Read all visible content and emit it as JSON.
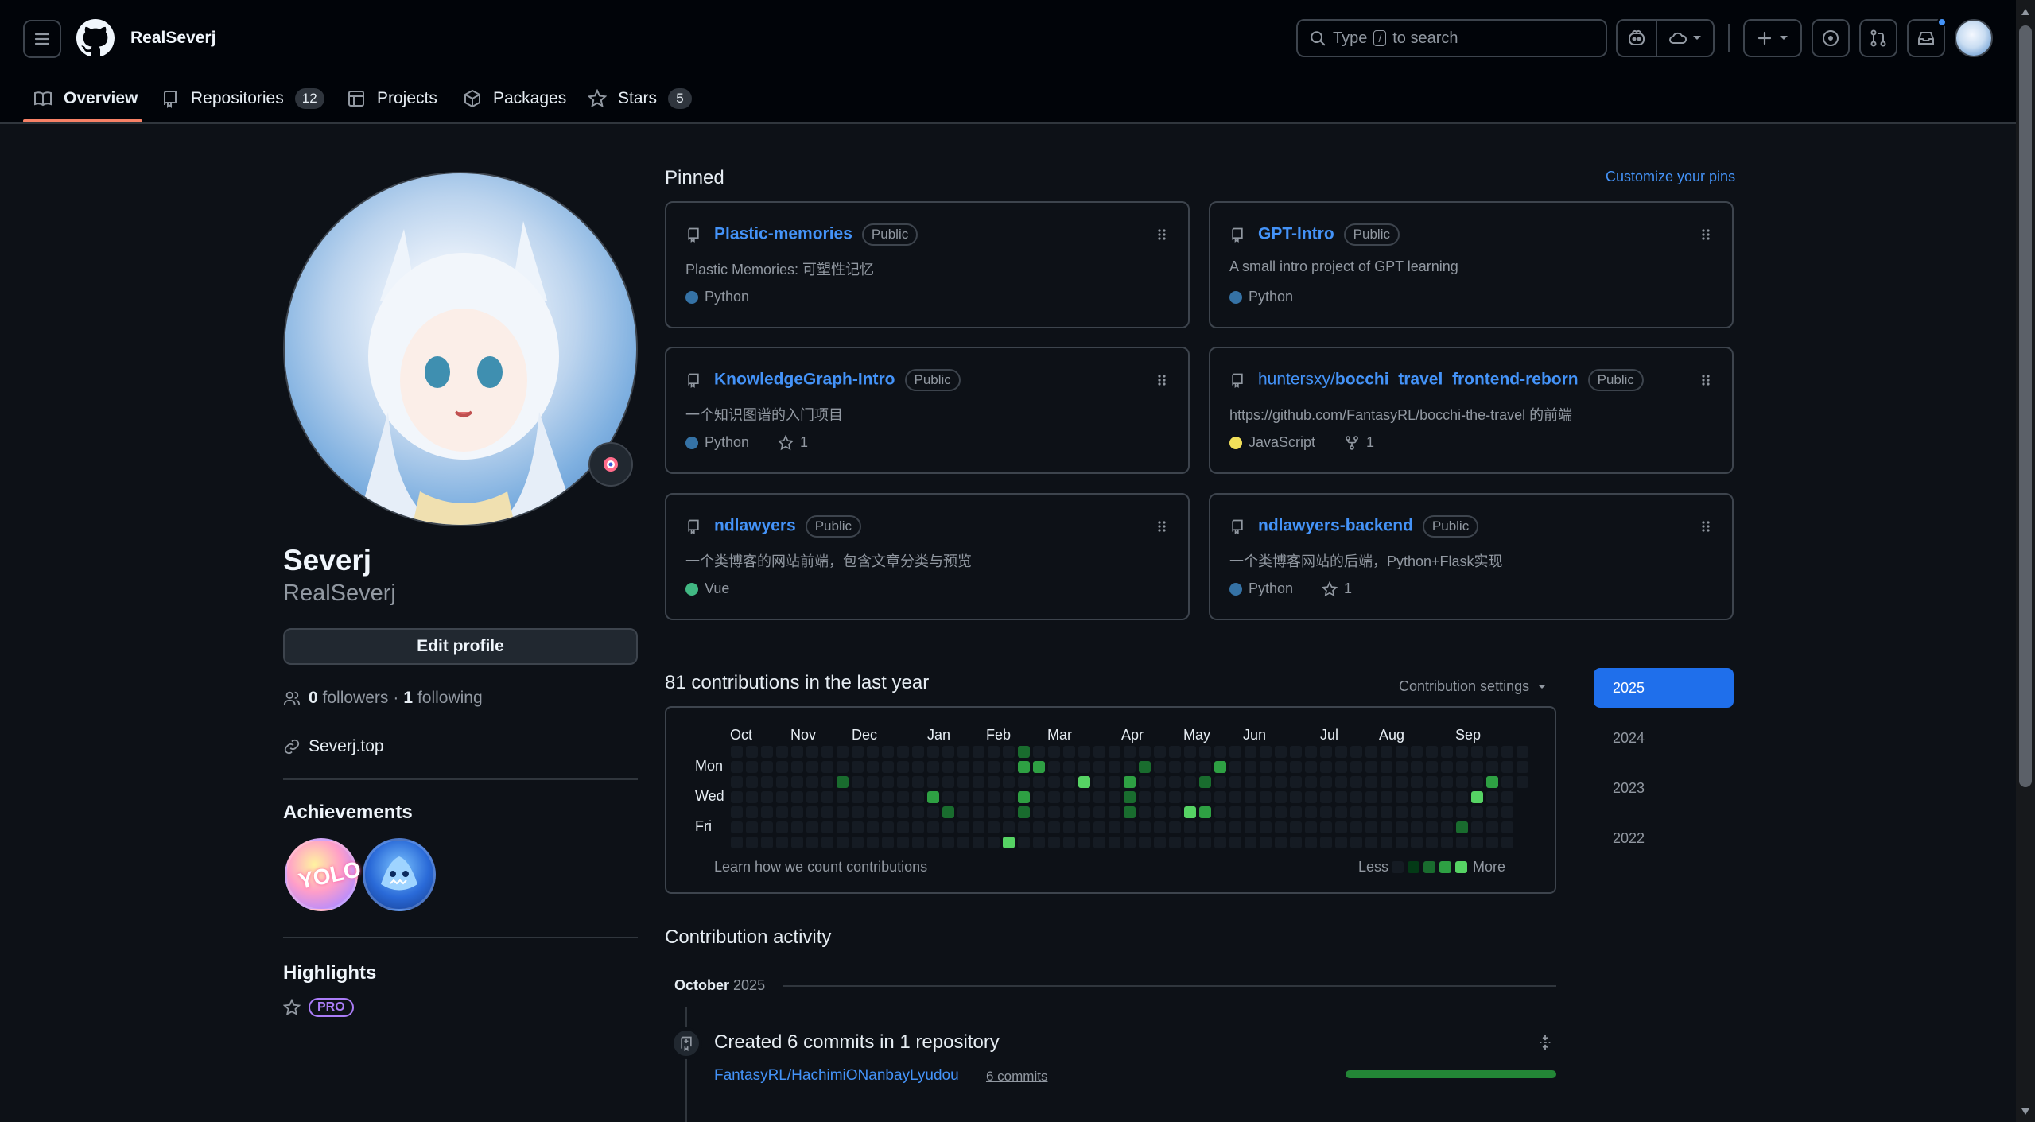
{
  "header": {
    "username": "RealSeverj",
    "search_prefix": "Type",
    "search_key": "/",
    "search_suffix": "to search"
  },
  "tabs": [
    {
      "label": "Overview",
      "count": null
    },
    {
      "label": "Repositories",
      "count": "12"
    },
    {
      "label": "Projects",
      "count": null
    },
    {
      "label": "Packages",
      "count": null
    },
    {
      "label": "Stars",
      "count": "5"
    }
  ],
  "profile": {
    "name": "Severj",
    "login": "RealSeverj",
    "edit_button": "Edit profile",
    "followers_count": "0",
    "followers_label": "followers",
    "separator": "·",
    "following_count": "1",
    "following_label": "following",
    "website": "Severj.top",
    "achievements_title": "Achievements",
    "highlights_title": "Highlights",
    "pro_badge": "PRO"
  },
  "pinned": {
    "title": "Pinned",
    "customize_link": "Customize your pins",
    "items": [
      {
        "name": "Plastic-memories",
        "visibility": "Public",
        "description": "Plastic Memories: 可塑性记忆",
        "language": "Python",
        "language_color": "#3572A5",
        "stars": null,
        "forks": null
      },
      {
        "name": "GPT-Intro",
        "visibility": "Public",
        "description": "A small intro project of GPT learning",
        "language": "Python",
        "language_color": "#3572A5",
        "stars": null,
        "forks": null
      },
      {
        "name": "KnowledgeGraph-Intro",
        "visibility": "Public",
        "description": "一个知识图谱的入门项目",
        "language": "Python",
        "language_color": "#3572A5",
        "stars": "1",
        "forks": null
      },
      {
        "owner": "huntersxy/",
        "name": "bocchi_travel_frontend-reborn",
        "visibility": "Public",
        "description": "https://github.com/FantasyRL/bocchi-the-travel 的前端",
        "language": "JavaScript",
        "language_color": "#f1e05a",
        "stars": null,
        "forks": "1"
      },
      {
        "name": "ndlawyers",
        "visibility": "Public",
        "description": "一个类博客的网站前端，包含文章分类与预览",
        "language": "Vue",
        "language_color": "#41b883",
        "stars": null,
        "forks": null
      },
      {
        "name": "ndlawyers-backend",
        "visibility": "Public",
        "description": "一个类博客网站的后端，Python+Flask实现",
        "language": "Python",
        "language_color": "#3572A5",
        "stars": "1",
        "forks": null
      }
    ]
  },
  "contributions": {
    "title": "81 contributions in the last year",
    "settings_label": "Contribution settings",
    "months": [
      "Oct",
      "Nov",
      "Dec",
      "Jan",
      "Feb",
      "Mar",
      "Apr",
      "May",
      "Jun",
      "Jul",
      "Aug",
      "Sep"
    ],
    "days": [
      "Mon",
      "Wed",
      "Fri"
    ],
    "learn_link": "Learn how we count contributions",
    "less": "Less",
    "more": "More",
    "years": [
      "2025",
      "2024",
      "2023",
      "2022"
    ],
    "active_year": "2025",
    "colors": [
      "#151b23",
      "#033a16",
      "#196c2e",
      "#2ea043",
      "#56d364"
    ]
  },
  "activity": {
    "title": "Contribution activity",
    "month": "October",
    "year": "2025",
    "event_title": "Created 6 commits in 1 repository",
    "repo": "FantasyRL/HachimiONanbayLyudou",
    "commits": "6 commits"
  }
}
